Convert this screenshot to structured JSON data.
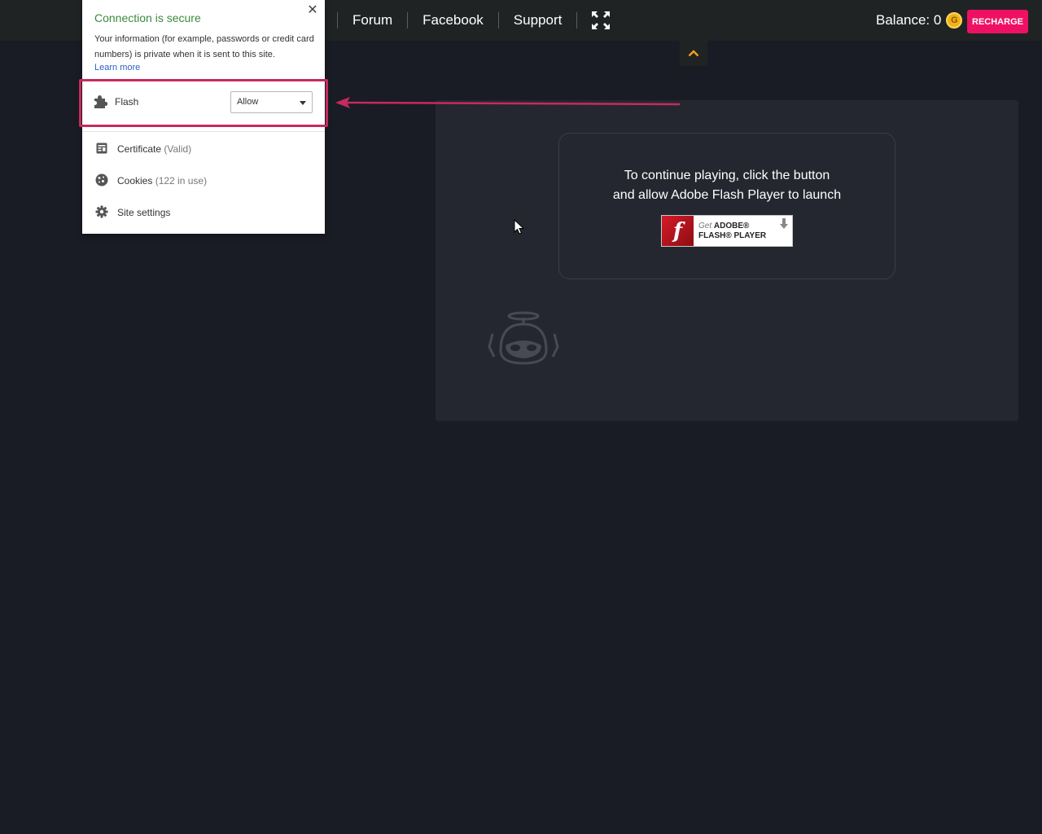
{
  "nav": {
    "links": [
      "Forum",
      "Facebook",
      "Support"
    ]
  },
  "account": {
    "balance_label": "Balance: 0",
    "coin_symbol": "G",
    "recharge_label": "RECHARGE"
  },
  "game": {
    "message_line1": "To continue playing, click the button",
    "message_line2": "and allow Adobe Flash Player to launch",
    "badge_get": "Get",
    "badge_adobe": "ADOBE®",
    "badge_flash": "FLASH® PLAYER",
    "flash_logo_glyph": "f"
  },
  "site_info": {
    "title": "Connection is secure",
    "description": "Your information (for example, passwords or credit card numbers) is private when it is sent to this site.",
    "learn_more": "Learn more",
    "flash_label": "Flash",
    "flash_value": "Allow",
    "certificate_label": "Certificate",
    "certificate_status": "(Valid)",
    "cookies_label": "Cookies",
    "cookies_status": "(122 in use)",
    "settings_label": "Site settings"
  },
  "colors": {
    "secure_green": "#3a8a3e",
    "recharge_pink": "#ee1163",
    "highlight_border": "#c62a5e",
    "collapse_arrow": "#f0a020"
  }
}
